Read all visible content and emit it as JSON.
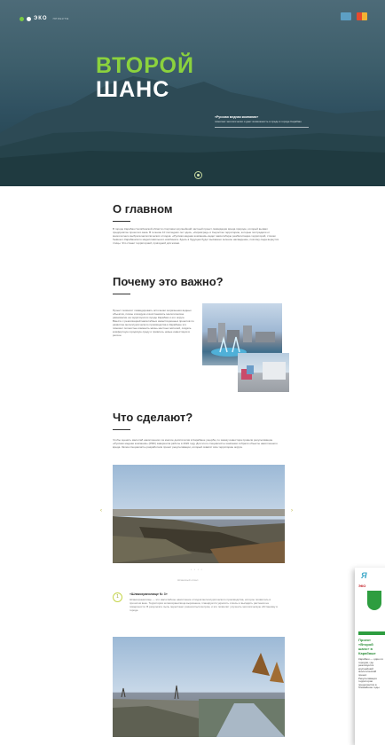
{
  "header": {
    "logo_text": "ЭКО",
    "logo_sub": "ПРОЕКТЫ"
  },
  "hero": {
    "title_line1": "ВТОРОЙ",
    "title_line2": "ШАНС",
    "quote_title": "«Русская медная компания»",
    "quote_text": "помогает экологически и дает возможность в среде в городе Карабаш"
  },
  "about": {
    "heading": "О главном",
    "text": "В городе Карабаш Челябинской области стартовал крупнейший частный проект ликвидации вреда природе, который вызвал предприятие прошлого века. В течение 10 последних лет здесь, «Кировград» и Сыростан территорию, которые пострадали от многолетнего выброса металлических отходов. «Русская медная компания» ведет масштабную реабилитацию территорий, стоком бывшего Карабашского медеплавильного комбината. Здесь в будущем будет высажено зеленое насаждение, поэтому сюда вернутся птицы. Это станет территорией, пригодной для жизни."
  },
  "why": {
    "heading": "Почему это важно?",
    "text": "Проект позволит ликвидировать источники загрязнения водных объектов, почвы и воздуха и восстановить экологическое равновесие на территории в городе Карабаш и его округе. Вместе с реализацией масштабных инвестиционных проектов по развитию металлургического производства в Карабаше это поможет полностью изменить жизнь местных жителей, создать комфортную городскую среду и привлечь новые инвестиции в регион."
  },
  "what": {
    "heading": "Что сделают?",
    "text": "Чтобы оценить масштаб накопленного за многие десятилетия в Карабаше ущерба, по заказу инвестора провели рекультивацию. «Русская медная компания» (РМК) завершила работы в 2020 году. Для этого специалисты компании собрали объекты накопленного вреда. Затем специалисты разработали проект рекультивации, который охватит всю территорию округа.",
    "gallery_caption": "Шлаковый отвал",
    "item_number": "1",
    "item_title": "«Шлакохранилище № 3»",
    "item_text": "Шлакохранилище — это масштабное накопление отходов металлургического производства, которое появилось в прошлом веке. Территория шлакохранилища выровнена, планируется укрепить откосы и высадить растения на поверхности. В результате пыль перестанет разноситься ветром, и это позволит улучшить экологическую обстановку в городе."
  },
  "news_clip": {
    "masthead": "Я",
    "red_tag": "ЭКО",
    "headline": "Проект «Второй шанс» в Карабаше",
    "body": "Карабаш — один из городов, где реализуется крупнейший экологический проект. Рекультивация территории продолжится в ближайшие годы."
  },
  "colors": {
    "accent_green": "#8bd23d",
    "hero_dark": "#2f5060"
  }
}
